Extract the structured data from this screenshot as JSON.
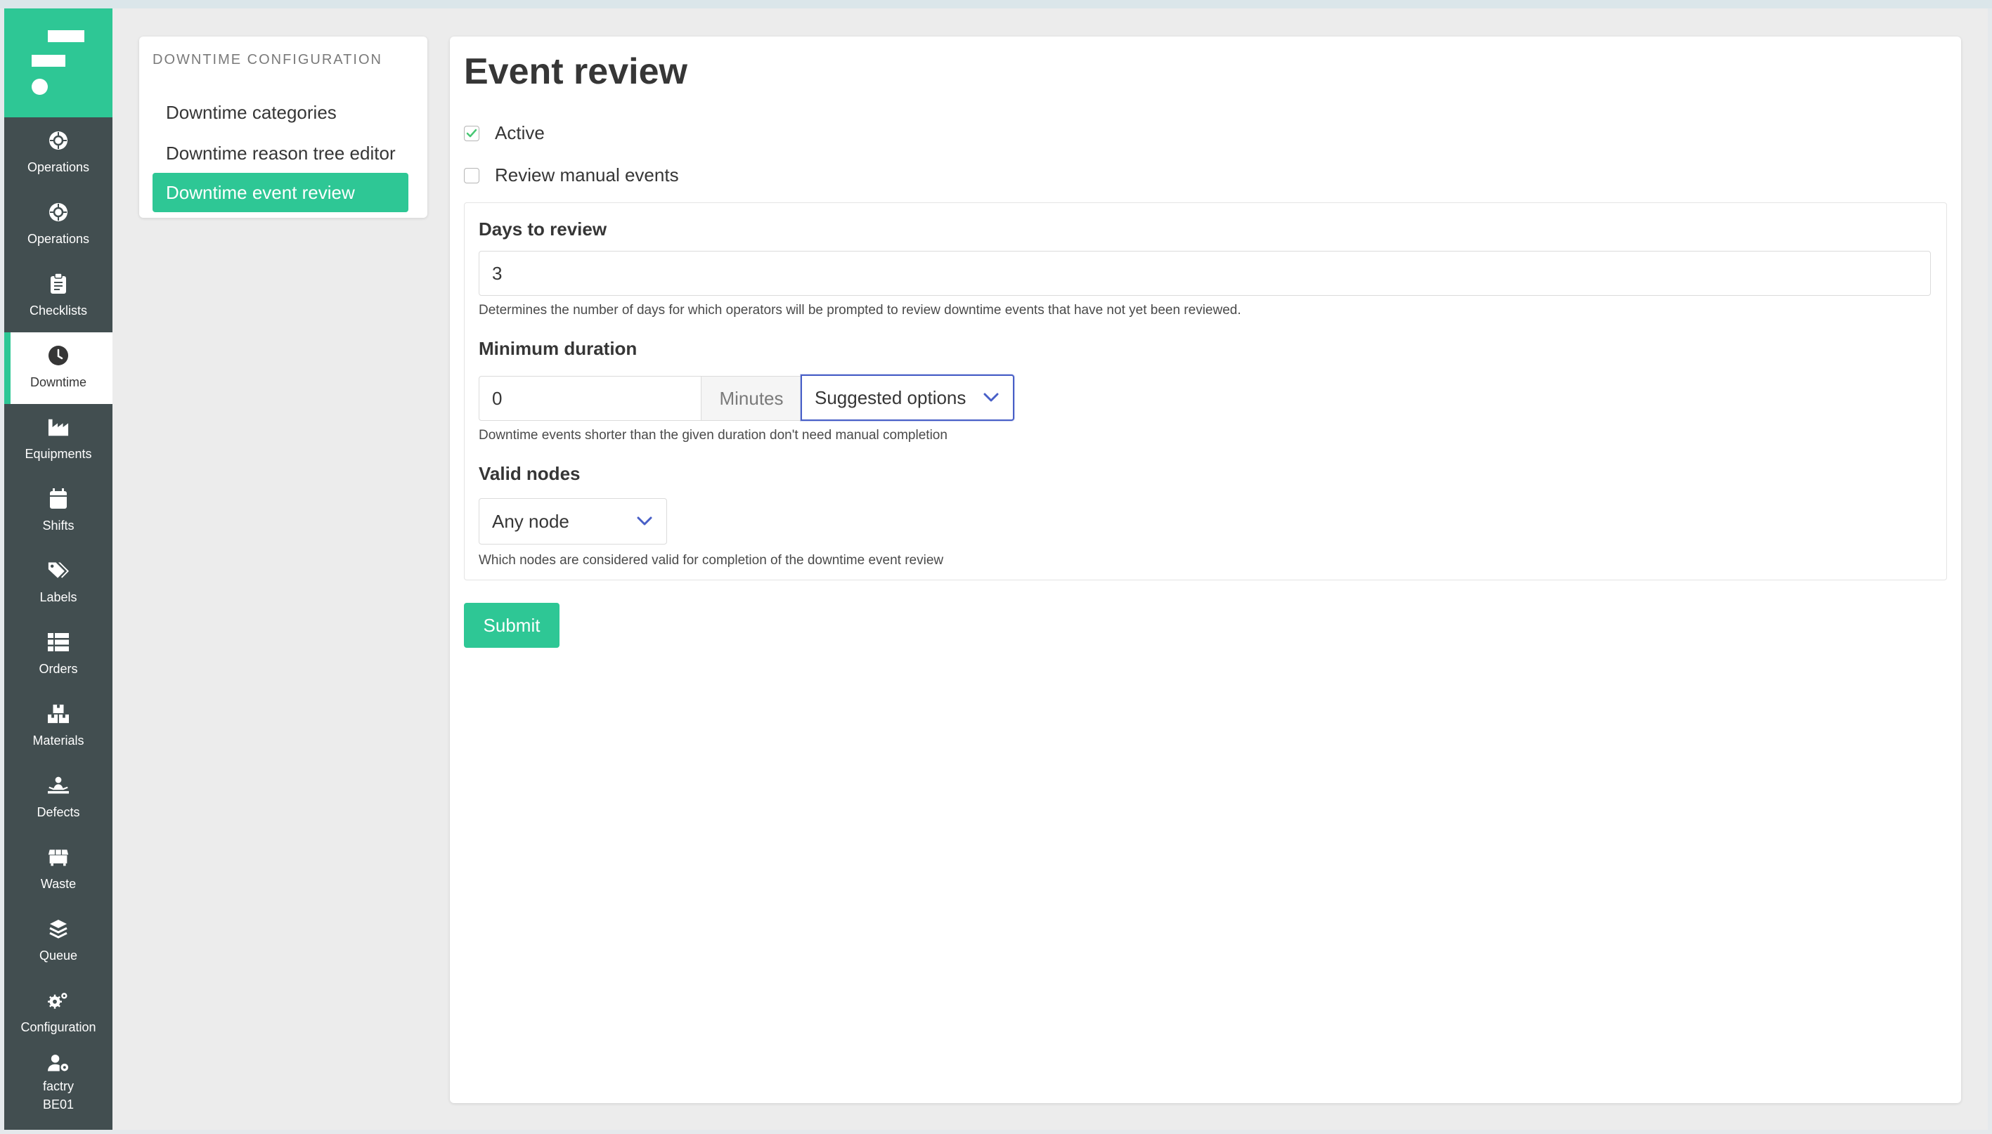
{
  "colors": {
    "brand": "#2ec795",
    "sidebar_bg": "#424e50",
    "focus": "#485fc7"
  },
  "sidebar": {
    "items": [
      {
        "label": "Operations",
        "icon": "globe-icon"
      },
      {
        "label": "Operations",
        "icon": "globe-icon"
      },
      {
        "label": "Checklists",
        "icon": "clipboard-icon"
      },
      {
        "label": "Downtime",
        "icon": "clock-icon",
        "active": true
      },
      {
        "label": "Equipments",
        "icon": "factory-icon"
      },
      {
        "label": "Shifts",
        "icon": "calendar-icon"
      },
      {
        "label": "Labels",
        "icon": "tags-icon"
      },
      {
        "label": "Orders",
        "icon": "list-icon"
      },
      {
        "label": "Materials",
        "icon": "boxes-icon"
      },
      {
        "label": "Defects",
        "icon": "person-broken-icon"
      },
      {
        "label": "Waste",
        "icon": "dumpster-icon"
      },
      {
        "label": "Queue",
        "icon": "layers-icon"
      },
      {
        "label": "Configuration",
        "icon": "gears-icon"
      }
    ],
    "user": {
      "line1": "factry",
      "line2": "BE01",
      "icon": "user-cog-icon"
    }
  },
  "config_menu": {
    "title": "DOWNTIME CONFIGURATION",
    "links": [
      {
        "label": "Downtime categories"
      },
      {
        "label": "Downtime reason tree editor"
      },
      {
        "label": "Downtime event review",
        "active": true
      }
    ]
  },
  "main": {
    "title": "Event review",
    "active_label": "Active",
    "active_checked": true,
    "review_manual_label": "Review manual events",
    "review_manual_checked": false,
    "days": {
      "label": "Days to review",
      "value": "3",
      "help": "Determines the number of days for which operators will be prompted to review downtime events that have not yet been reviewed."
    },
    "min_duration": {
      "label": "Minimum duration",
      "value": "0",
      "unit": "Minutes",
      "suggested": "Suggested options",
      "help": "Downtime events shorter than the given duration don't need manual completion"
    },
    "valid_nodes": {
      "label": "Valid nodes",
      "value": "Any node",
      "help": "Which nodes are considered valid for completion of the downtime event review"
    },
    "submit_label": "Submit"
  }
}
